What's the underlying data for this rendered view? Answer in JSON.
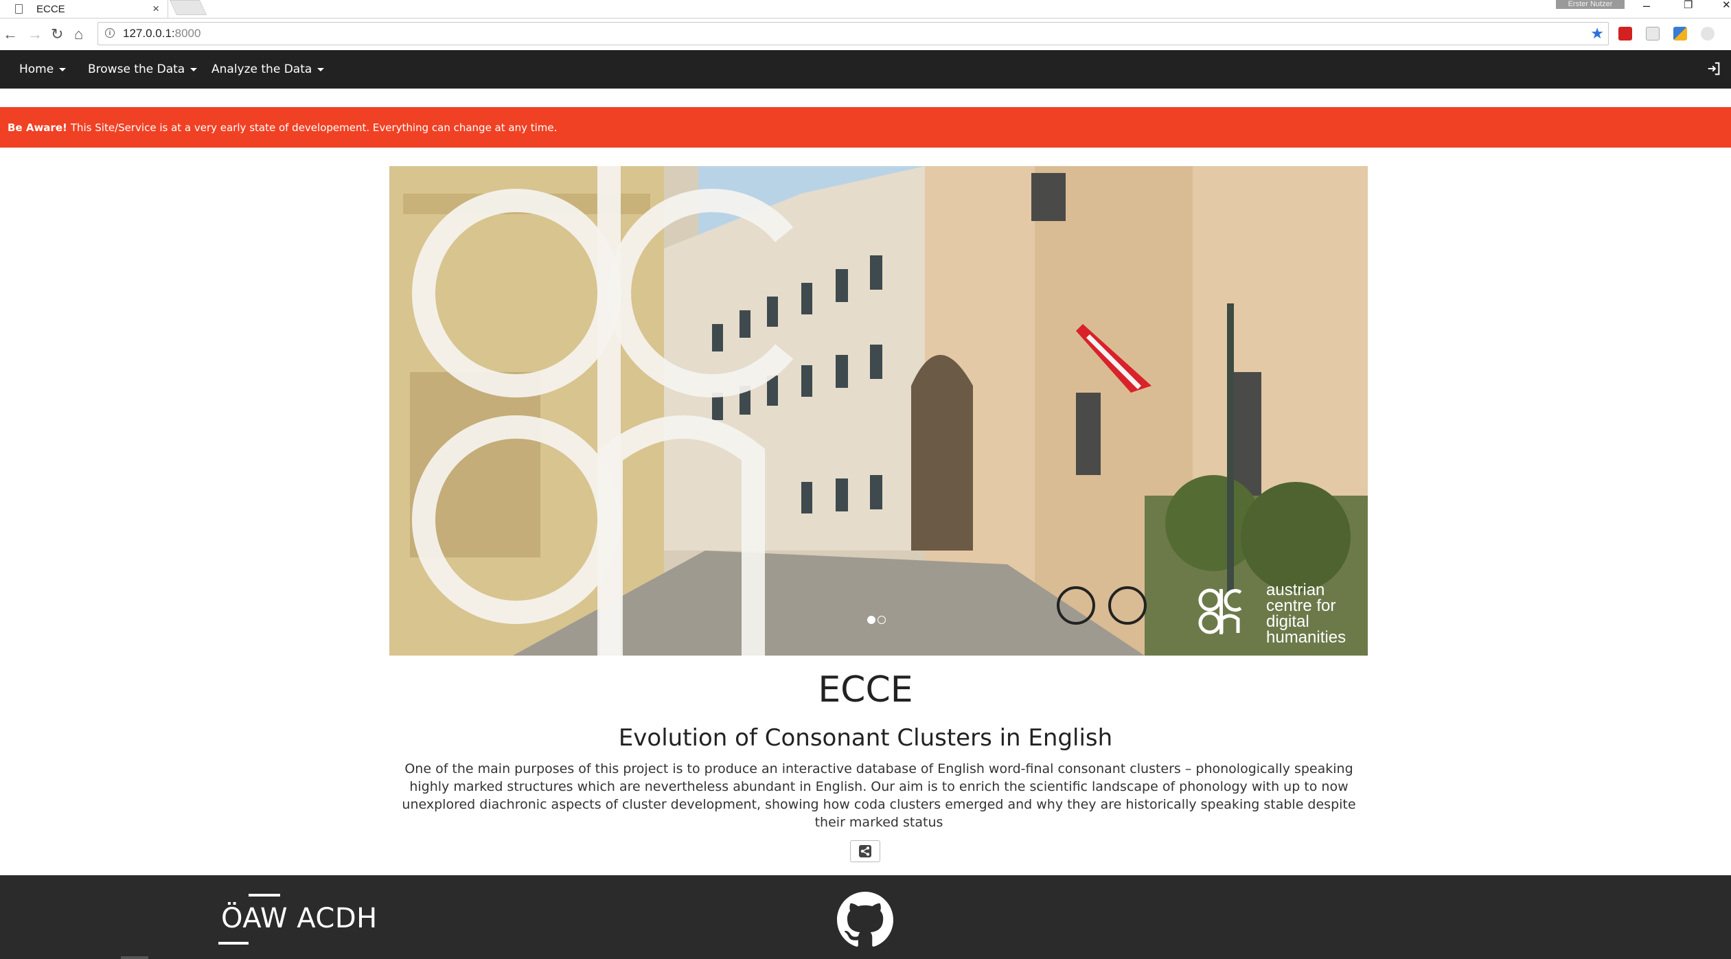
{
  "browser": {
    "tab_title": "ECCE",
    "tab_close": "×",
    "profile_badge": "Erster Nutzer",
    "url_host": "127.0.0.1:",
    "url_port": "8000",
    "window_minimize": "–",
    "window_restore": "❐",
    "window_close": "✕"
  },
  "navbar": {
    "items": [
      {
        "label": "Home"
      },
      {
        "label": "Browse the Data"
      },
      {
        "label": "Analyze the Data"
      }
    ]
  },
  "alert": {
    "strong": "Be Aware!",
    "message": "This Site/Service is at a very early state of developement. Everything can change at any time."
  },
  "carousel": {
    "logo_lines": [
      "austrian",
      "centre for",
      "digital",
      "humanities"
    ],
    "slide_count": 2,
    "active_slide": 1
  },
  "main": {
    "title": "ECCE",
    "subtitle": "Evolution of Consonant Clusters in English",
    "description": "One of the main purposes of this project is to produce an interactive database of English word-final consonant clusters – phonologically speaking highly marked structures which are nevertheless abundant in English. Our aim is to enrich the scientific landscape of phonology with up to now unexplored diachronic aspects of cluster development, showing how coda clusters emerged and why they are historically speaking stable despite their marked status"
  },
  "footer": {
    "logo_bold": "ÖAW",
    "logo_light": "ACDH"
  },
  "colors": {
    "navbar": "#222222",
    "alert": "#f04124",
    "footer": "#2b2b2b"
  }
}
